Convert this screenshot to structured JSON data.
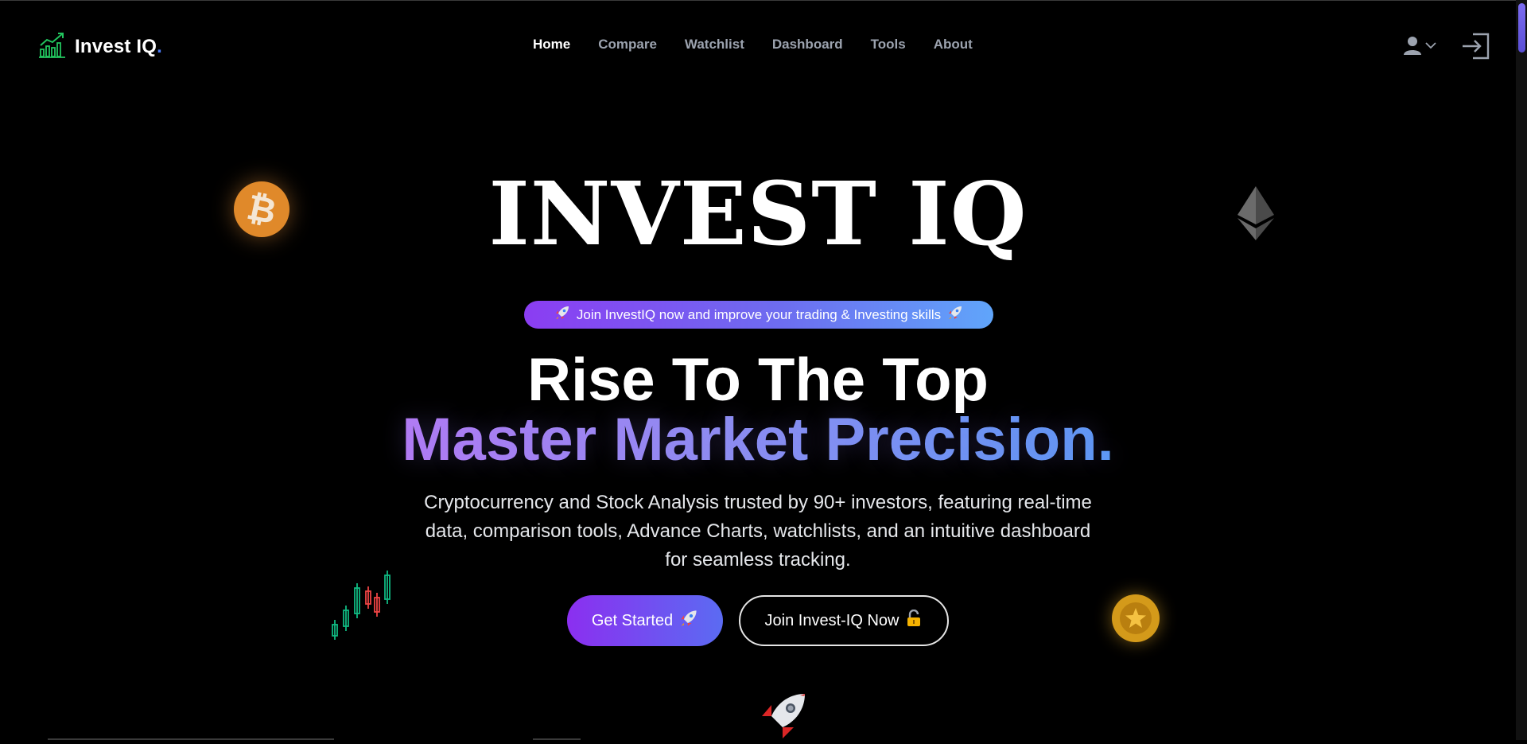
{
  "nav": {
    "logo_text": "Invest IQ",
    "logo_dot": ".",
    "links": [
      {
        "label": "Home",
        "active": true
      },
      {
        "label": "Compare",
        "active": false
      },
      {
        "label": "Watchlist",
        "active": false
      },
      {
        "label": "Dashboard",
        "active": false
      },
      {
        "label": "Tools",
        "active": false
      },
      {
        "label": "About",
        "active": false
      }
    ],
    "user_icon": "user-icon",
    "login_icon": "sign-in-icon"
  },
  "hero": {
    "title": "INVEST IQ",
    "pill_text": "Join InvestIQ now and improve your trading & Investing skills",
    "headline_line1": "Rise To The Top",
    "headline_line2": "Master Market Precision.",
    "description": "Cryptocurrency and Stock Analysis trusted by 90+ investors, featuring real-time data, comparison tools, Advance Charts, watchlists, and an intuitive dashboard for seamless tracking.",
    "primary_button": "Get Started",
    "secondary_button": "Join Invest-IQ Now"
  },
  "decor": {
    "bitcoin_glyph": "₿",
    "icons": [
      "bitcoin-icon",
      "ethereum-icon",
      "candlestick-icon",
      "star-coin-icon",
      "rocket-icon",
      "lock-icon"
    ]
  },
  "colors": {
    "accent_purple": "#8b2ff0",
    "accent_blue": "#5b9af5",
    "logo_green": "#22c55e",
    "bitcoin_orange": "#e0892a"
  }
}
